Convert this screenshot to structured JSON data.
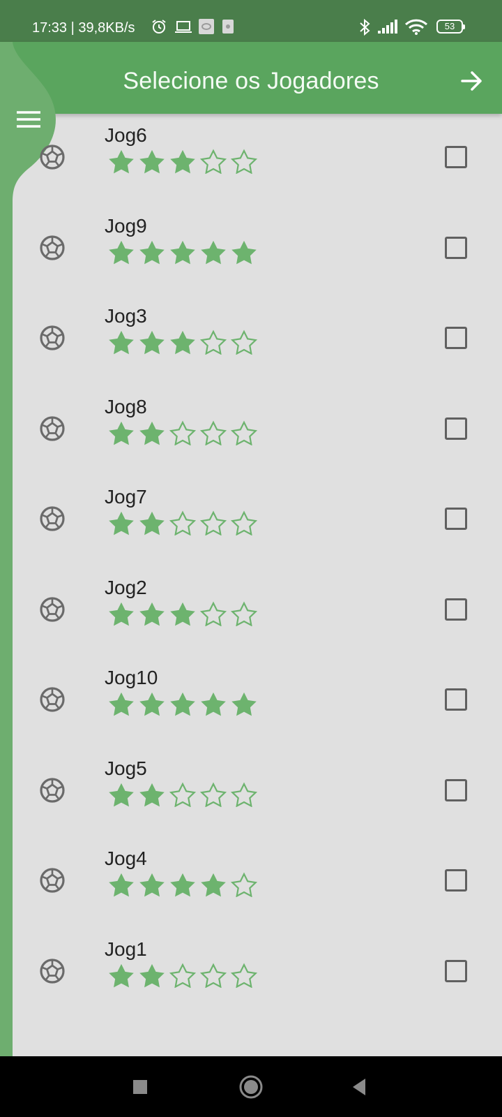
{
  "status_bar": {
    "time_speed": "17:33 | 39,8KB/s",
    "battery_level": "53",
    "icons": [
      "alarm-icon",
      "laptop-icon",
      "app-notification-icon",
      "notification-icon",
      "bluetooth-icon",
      "signal-icon",
      "wifi-icon",
      "battery-icon"
    ]
  },
  "app_bar": {
    "title": "Selecione os Jogadores",
    "menu_icon": "hamburger-menu-icon",
    "next_icon": "arrow-right-icon"
  },
  "colors": {
    "accent": "#5aa55e",
    "star": "#6db36e",
    "status_bar": "#4a7e4b",
    "background": "#e0e0e0"
  },
  "players": [
    {
      "name": "Jog6",
      "rating": 3,
      "max_rating": 5,
      "selected": false
    },
    {
      "name": "Jog9",
      "rating": 5,
      "max_rating": 5,
      "selected": false
    },
    {
      "name": "Jog3",
      "rating": 3,
      "max_rating": 5,
      "selected": false
    },
    {
      "name": "Jog8",
      "rating": 2,
      "max_rating": 5,
      "selected": false
    },
    {
      "name": "Jog7",
      "rating": 2,
      "max_rating": 5,
      "selected": false
    },
    {
      "name": "Jog2",
      "rating": 3,
      "max_rating": 5,
      "selected": false
    },
    {
      "name": "Jog10",
      "rating": 5,
      "max_rating": 5,
      "selected": false
    },
    {
      "name": "Jog5",
      "rating": 2,
      "max_rating": 5,
      "selected": false
    },
    {
      "name": "Jog4",
      "rating": 4,
      "max_rating": 5,
      "selected": false
    },
    {
      "name": "Jog1",
      "rating": 2,
      "max_rating": 5,
      "selected": false
    }
  ],
  "nav_bar": {
    "buttons": [
      "recents-square-icon",
      "home-circle-icon",
      "back-triangle-icon"
    ]
  }
}
